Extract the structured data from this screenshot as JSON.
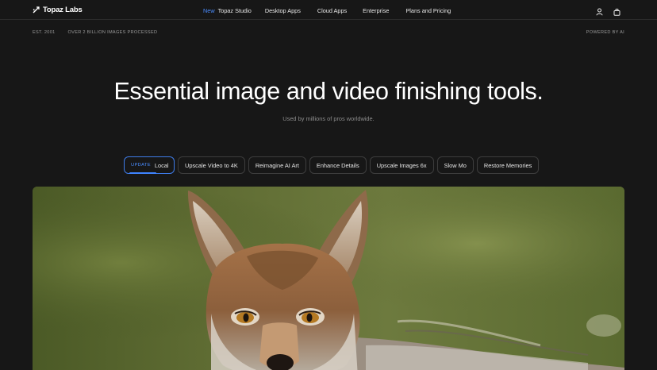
{
  "nav": {
    "brand": "Topaz Labs",
    "links": [
      {
        "badge": "New",
        "label": "Topaz Studio"
      },
      {
        "label": "Desktop Apps"
      },
      {
        "label": "Cloud Apps"
      },
      {
        "label": "Enterprise"
      },
      {
        "label": "Plans and Pricing"
      }
    ],
    "icons": [
      "user-icon",
      "bag-icon"
    ]
  },
  "subbar": {
    "est": "EST. 2001",
    "processed": "OVER 2 BILLION IMAGES PROCESSED",
    "powered": "POWERED BY AI"
  },
  "hero": {
    "title": "Essential image and video finishing tools.",
    "subtitle": "Used by millions of pros worldwide."
  },
  "tabs": [
    {
      "badge": "UPDATE",
      "label": "Local",
      "active": true
    },
    {
      "label": "Upscale Video to 4K"
    },
    {
      "label": "Reimagine AI Art"
    },
    {
      "label": "Enhance Details"
    },
    {
      "label": "Upscale Images 6x"
    },
    {
      "label": "Slow Mo"
    },
    {
      "label": "Restore Memories"
    }
  ],
  "colors": {
    "background": "#171717",
    "accent": "#3f84ff",
    "text": "#f2f2f2",
    "muted": "#8d8d8d"
  }
}
